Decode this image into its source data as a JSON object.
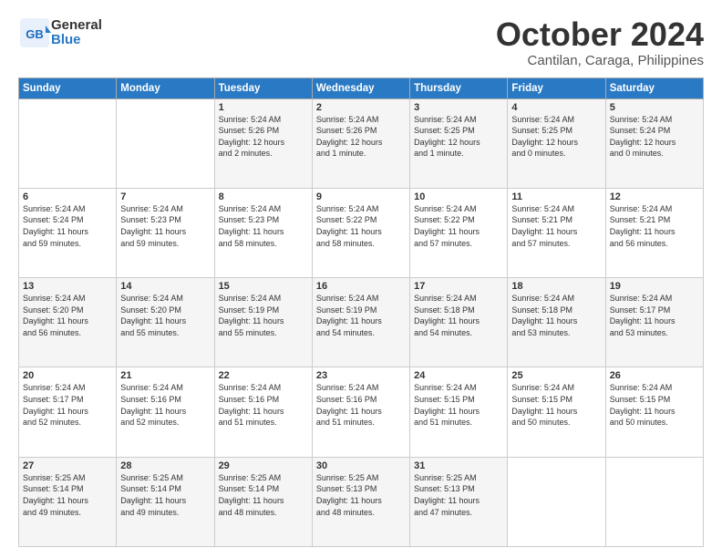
{
  "header": {
    "logo_line1": "General",
    "logo_line2": "Blue",
    "month": "October 2024",
    "location": "Cantilan, Caraga, Philippines"
  },
  "weekdays": [
    "Sunday",
    "Monday",
    "Tuesday",
    "Wednesday",
    "Thursday",
    "Friday",
    "Saturday"
  ],
  "weeks": [
    [
      {
        "day": "",
        "info": ""
      },
      {
        "day": "",
        "info": ""
      },
      {
        "day": "1",
        "info": "Sunrise: 5:24 AM\nSunset: 5:26 PM\nDaylight: 12 hours\nand 2 minutes."
      },
      {
        "day": "2",
        "info": "Sunrise: 5:24 AM\nSunset: 5:26 PM\nDaylight: 12 hours\nand 1 minute."
      },
      {
        "day": "3",
        "info": "Sunrise: 5:24 AM\nSunset: 5:25 PM\nDaylight: 12 hours\nand 1 minute."
      },
      {
        "day": "4",
        "info": "Sunrise: 5:24 AM\nSunset: 5:25 PM\nDaylight: 12 hours\nand 0 minutes."
      },
      {
        "day": "5",
        "info": "Sunrise: 5:24 AM\nSunset: 5:24 PM\nDaylight: 12 hours\nand 0 minutes."
      }
    ],
    [
      {
        "day": "6",
        "info": "Sunrise: 5:24 AM\nSunset: 5:24 PM\nDaylight: 11 hours\nand 59 minutes."
      },
      {
        "day": "7",
        "info": "Sunrise: 5:24 AM\nSunset: 5:23 PM\nDaylight: 11 hours\nand 59 minutes."
      },
      {
        "day": "8",
        "info": "Sunrise: 5:24 AM\nSunset: 5:23 PM\nDaylight: 11 hours\nand 58 minutes."
      },
      {
        "day": "9",
        "info": "Sunrise: 5:24 AM\nSunset: 5:22 PM\nDaylight: 11 hours\nand 58 minutes."
      },
      {
        "day": "10",
        "info": "Sunrise: 5:24 AM\nSunset: 5:22 PM\nDaylight: 11 hours\nand 57 minutes."
      },
      {
        "day": "11",
        "info": "Sunrise: 5:24 AM\nSunset: 5:21 PM\nDaylight: 11 hours\nand 57 minutes."
      },
      {
        "day": "12",
        "info": "Sunrise: 5:24 AM\nSunset: 5:21 PM\nDaylight: 11 hours\nand 56 minutes."
      }
    ],
    [
      {
        "day": "13",
        "info": "Sunrise: 5:24 AM\nSunset: 5:20 PM\nDaylight: 11 hours\nand 56 minutes."
      },
      {
        "day": "14",
        "info": "Sunrise: 5:24 AM\nSunset: 5:20 PM\nDaylight: 11 hours\nand 55 minutes."
      },
      {
        "day": "15",
        "info": "Sunrise: 5:24 AM\nSunset: 5:19 PM\nDaylight: 11 hours\nand 55 minutes."
      },
      {
        "day": "16",
        "info": "Sunrise: 5:24 AM\nSunset: 5:19 PM\nDaylight: 11 hours\nand 54 minutes."
      },
      {
        "day": "17",
        "info": "Sunrise: 5:24 AM\nSunset: 5:18 PM\nDaylight: 11 hours\nand 54 minutes."
      },
      {
        "day": "18",
        "info": "Sunrise: 5:24 AM\nSunset: 5:18 PM\nDaylight: 11 hours\nand 53 minutes."
      },
      {
        "day": "19",
        "info": "Sunrise: 5:24 AM\nSunset: 5:17 PM\nDaylight: 11 hours\nand 53 minutes."
      }
    ],
    [
      {
        "day": "20",
        "info": "Sunrise: 5:24 AM\nSunset: 5:17 PM\nDaylight: 11 hours\nand 52 minutes."
      },
      {
        "day": "21",
        "info": "Sunrise: 5:24 AM\nSunset: 5:16 PM\nDaylight: 11 hours\nand 52 minutes."
      },
      {
        "day": "22",
        "info": "Sunrise: 5:24 AM\nSunset: 5:16 PM\nDaylight: 11 hours\nand 51 minutes."
      },
      {
        "day": "23",
        "info": "Sunrise: 5:24 AM\nSunset: 5:16 PM\nDaylight: 11 hours\nand 51 minutes."
      },
      {
        "day": "24",
        "info": "Sunrise: 5:24 AM\nSunset: 5:15 PM\nDaylight: 11 hours\nand 51 minutes."
      },
      {
        "day": "25",
        "info": "Sunrise: 5:24 AM\nSunset: 5:15 PM\nDaylight: 11 hours\nand 50 minutes."
      },
      {
        "day": "26",
        "info": "Sunrise: 5:24 AM\nSunset: 5:15 PM\nDaylight: 11 hours\nand 50 minutes."
      }
    ],
    [
      {
        "day": "27",
        "info": "Sunrise: 5:25 AM\nSunset: 5:14 PM\nDaylight: 11 hours\nand 49 minutes."
      },
      {
        "day": "28",
        "info": "Sunrise: 5:25 AM\nSunset: 5:14 PM\nDaylight: 11 hours\nand 49 minutes."
      },
      {
        "day": "29",
        "info": "Sunrise: 5:25 AM\nSunset: 5:14 PM\nDaylight: 11 hours\nand 48 minutes."
      },
      {
        "day": "30",
        "info": "Sunrise: 5:25 AM\nSunset: 5:13 PM\nDaylight: 11 hours\nand 48 minutes."
      },
      {
        "day": "31",
        "info": "Sunrise: 5:25 AM\nSunset: 5:13 PM\nDaylight: 11 hours\nand 47 minutes."
      },
      {
        "day": "",
        "info": ""
      },
      {
        "day": "",
        "info": ""
      }
    ]
  ]
}
